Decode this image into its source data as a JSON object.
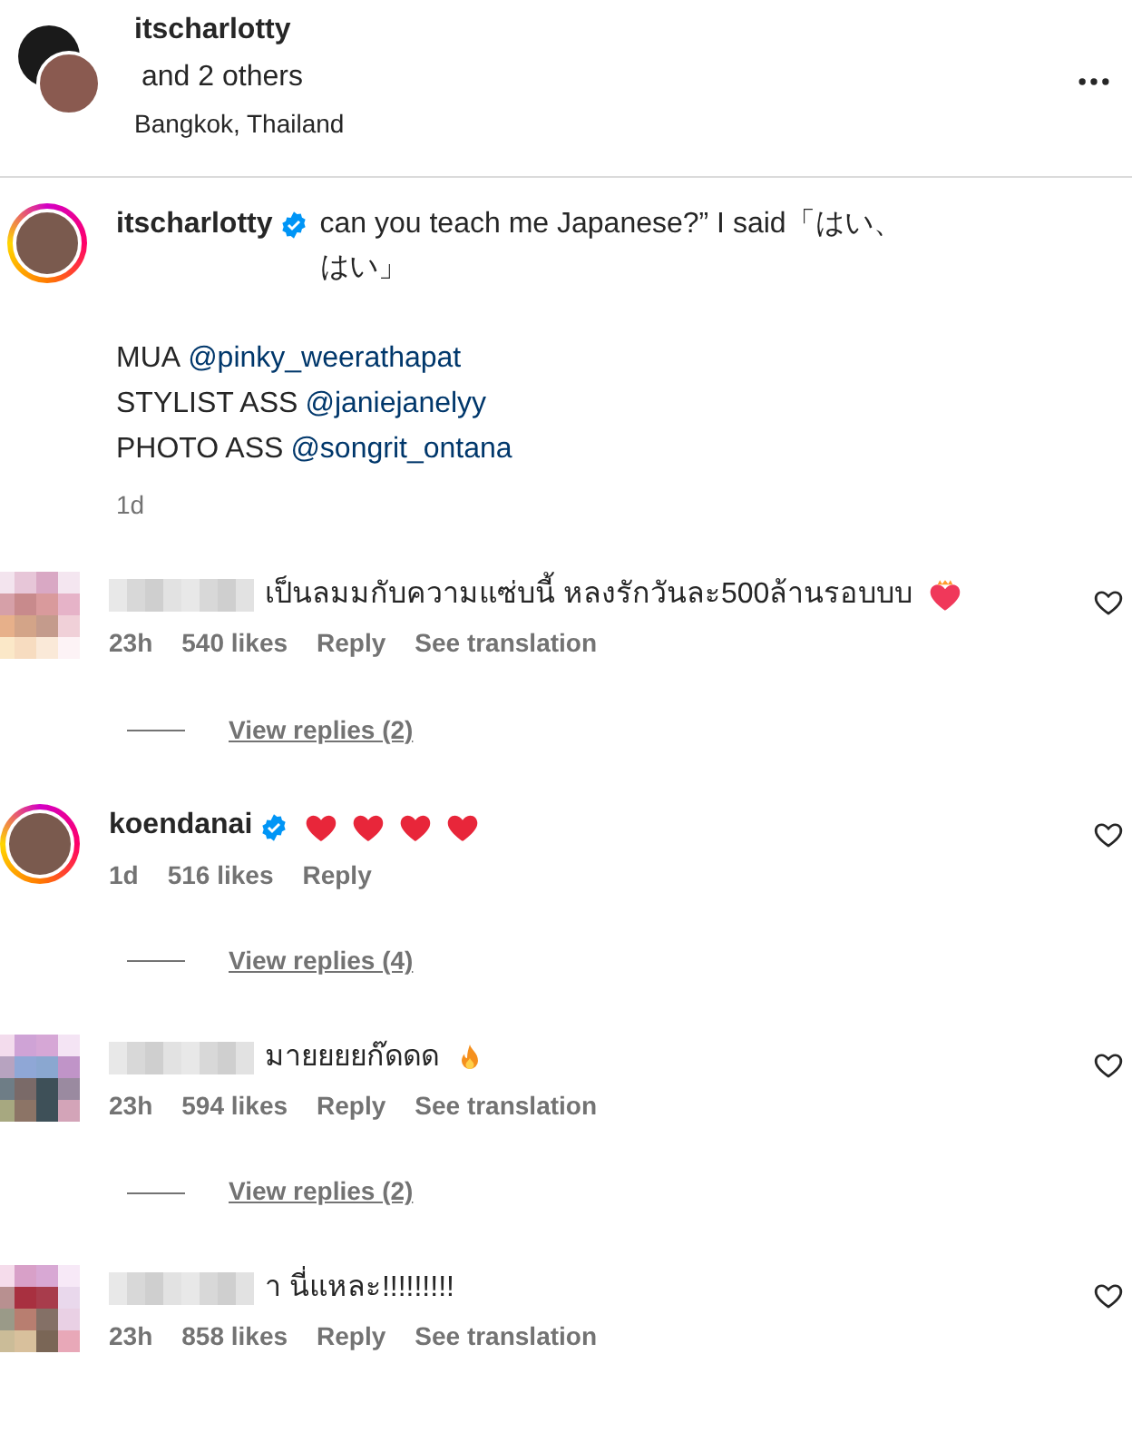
{
  "header": {
    "username": "itscharlotty",
    "others": "and 2 others",
    "location": "Bangkok, Thailand"
  },
  "caption": {
    "username": "itscharlotty",
    "verified": true,
    "story_ring": true,
    "text": "can you teach me Japanese?” I said「はい、はい」",
    "credits": [
      {
        "label": "MUA",
        "handle": "@pinky_weerathapat"
      },
      {
        "label": "STYLIST ASS",
        "handle": "@janiejanelyy"
      },
      {
        "label": "PHOTO ASS",
        "handle": "@songrit_ontana"
      }
    ],
    "time": "1d"
  },
  "comments": [
    {
      "redacted": true,
      "story_ring": false,
      "text": "เป็นลมมกับความแซ่บนี้ หลงรักวันละ500ล้านรอบบบ",
      "emoji": [
        {
          "kind": "heart-fire"
        }
      ],
      "time": "23h",
      "likes": "540 likes",
      "reply": "Reply",
      "translation": "See translation",
      "view_replies": "View replies (2)"
    },
    {
      "redacted": false,
      "username": "koendanai",
      "verified": true,
      "story_ring": true,
      "emoji": [
        {
          "kind": "heart"
        },
        {
          "kind": "heart"
        },
        {
          "kind": "heart"
        },
        {
          "kind": "heart"
        }
      ],
      "time": "1d",
      "likes": "516 likes",
      "reply": "Reply",
      "view_replies": "View replies (4)"
    },
    {
      "redacted": true,
      "story_ring": false,
      "text": "มายยยยก๊ดดด",
      "emoji": [
        {
          "kind": "fire"
        }
      ],
      "time": "23h",
      "likes": "594 likes",
      "reply": "Reply",
      "translation": "See translation",
      "view_replies": "View replies (2)"
    },
    {
      "redacted": true,
      "story_ring": false,
      "text": "า นี่แหละ!!!!!!!!!",
      "time": "23h",
      "likes": "858 likes",
      "reply": "Reply",
      "translation": "See translation"
    }
  ]
}
